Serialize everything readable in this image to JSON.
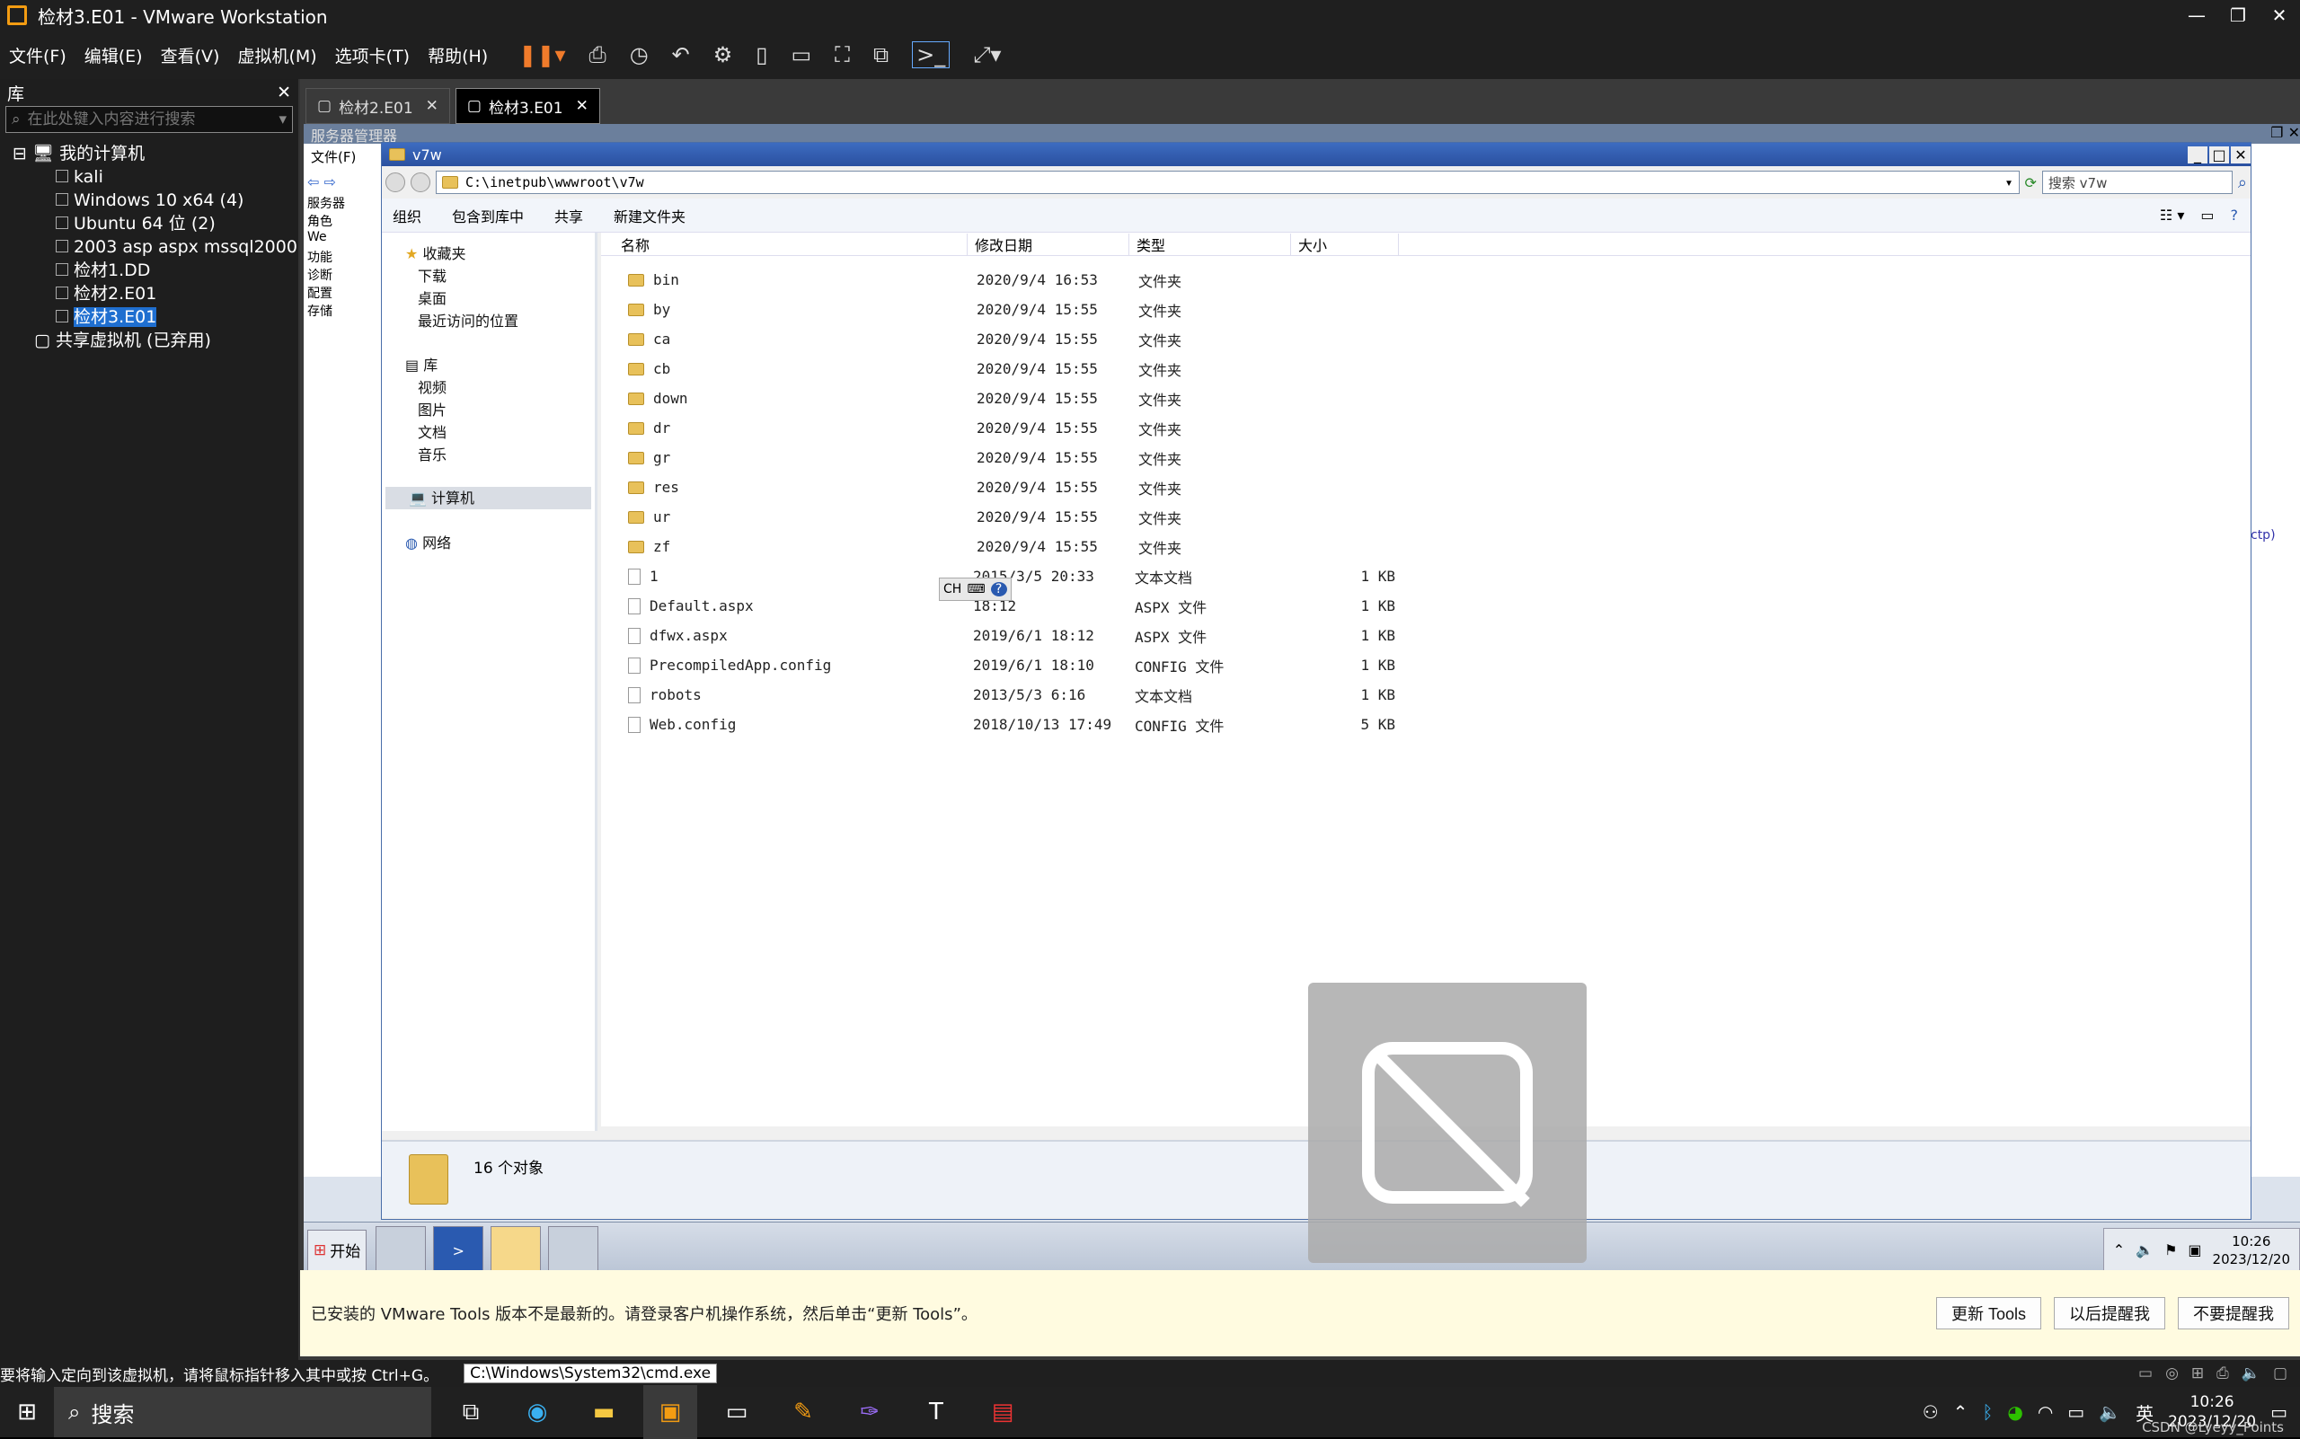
{
  "title": {
    "text": "检材3.E01 - VMware Workstation"
  },
  "menu": [
    "文件(F)",
    "编辑(E)",
    "查看(V)",
    "虚拟机(M)",
    "选项卡(T)",
    "帮助(H)"
  ],
  "library": {
    "title": "库",
    "search_placeholder": "在此处键入内容进行搜索",
    "root": "我的计算机",
    "items": [
      "kali",
      "Windows 10 x64 (4)",
      "Ubuntu 64 位 (2)",
      "2003 asp aspx mssql2000",
      "检材1.DD",
      "检材2.E01",
      "检材3.E01"
    ],
    "shared": "共享虚拟机 (已弃用)"
  },
  "tabs": [
    "检材2.E01",
    "检材3.E01"
  ],
  "guest": {
    "server_manager": "服务器管理器",
    "file_menu": "文件(F)",
    "tree": [
      "服务器",
      "角色",
      "We",
      "功能",
      "诊断",
      "配置",
      "存储"
    ],
    "explorer": {
      "title": "v7w",
      "address": "C:\\inetpub\\wwwroot\\v7w",
      "search_placeholder": "搜索 v7w",
      "toolbar": [
        "组织",
        "包含到库中",
        "共享",
        "新建文件夹"
      ],
      "nav": {
        "favorites": "收藏夹",
        "fav_items": [
          "下载",
          "桌面",
          "最近访问的位置"
        ],
        "libraries": "库",
        "lib_items": [
          "视频",
          "图片",
          "文档",
          "音乐"
        ],
        "computer": "计算机",
        "network": "网络"
      },
      "columns": [
        "名称",
        "修改日期",
        "类型",
        "大小"
      ],
      "files": [
        {
          "name": "bin",
          "date": "2020/9/4 16:53",
          "type": "文件夹",
          "size": "",
          "kind": "folder"
        },
        {
          "name": "by",
          "date": "2020/9/4 15:55",
          "type": "文件夹",
          "size": "",
          "kind": "folder"
        },
        {
          "name": "ca",
          "date": "2020/9/4 15:55",
          "type": "文件夹",
          "size": "",
          "kind": "folder"
        },
        {
          "name": "cb",
          "date": "2020/9/4 15:55",
          "type": "文件夹",
          "size": "",
          "kind": "folder"
        },
        {
          "name": "down",
          "date": "2020/9/4 15:55",
          "type": "文件夹",
          "size": "",
          "kind": "folder"
        },
        {
          "name": "dr",
          "date": "2020/9/4 15:55",
          "type": "文件夹",
          "size": "",
          "kind": "folder"
        },
        {
          "name": "gr",
          "date": "2020/9/4 15:55",
          "type": "文件夹",
          "size": "",
          "kind": "folder"
        },
        {
          "name": "res",
          "date": "2020/9/4 15:55",
          "type": "文件夹",
          "size": "",
          "kind": "folder"
        },
        {
          "name": "ur",
          "date": "2020/9/4 15:55",
          "type": "文件夹",
          "size": "",
          "kind": "folder"
        },
        {
          "name": "zf",
          "date": "2020/9/4 15:55",
          "type": "文件夹",
          "size": "",
          "kind": "folder"
        },
        {
          "name": "1",
          "date": "2015/3/5 20:33",
          "type": "文本文档",
          "size": "1 KB",
          "kind": "file"
        },
        {
          "name": "Default.aspx",
          "date": "18:12",
          "type": "ASPX 文件",
          "size": "1 KB",
          "kind": "file"
        },
        {
          "name": "dfwx.aspx",
          "date": "2019/6/1 18:12",
          "type": "ASPX 文件",
          "size": "1 KB",
          "kind": "file"
        },
        {
          "name": "PrecompiledApp.config",
          "date": "2019/6/1 18:10",
          "type": "CONFIG 文件",
          "size": "1 KB",
          "kind": "file"
        },
        {
          "name": "robots",
          "date": "2013/5/3 6:16",
          "type": "文本文档",
          "size": "1 KB",
          "kind": "file"
        },
        {
          "name": "Web.config",
          "date": "2018/10/13 17:49",
          "type": "CONFIG 文件",
          "size": "5 KB",
          "kind": "file"
        }
      ],
      "status": "16 个对象",
      "ime": "CH"
    },
    "taskbar": {
      "start": "开始",
      "time": "10:26",
      "date": "2023/12/20"
    },
    "right_frag": "ctp)"
  },
  "tools_bar": {
    "message": "已安装的 VMware Tools 版本不是最新的。请登录客户机操作系统，然后单击“更新 Tools”。",
    "update": "更新 Tools",
    "later": "以后提醒我",
    "never": "不要提醒我"
  },
  "statusbar": {
    "hint": "要将输入定向到该虚拟机，请将鼠标指针移入其中或按 Ctrl+G。",
    "tooltip": "C:\\Windows\\System32\\cmd.exe"
  },
  "host_taskbar": {
    "search": "搜索",
    "ime": "英",
    "time": "10:26",
    "date": "2023/12/20",
    "watermark": "CSDN @Lyeyy_Points"
  }
}
